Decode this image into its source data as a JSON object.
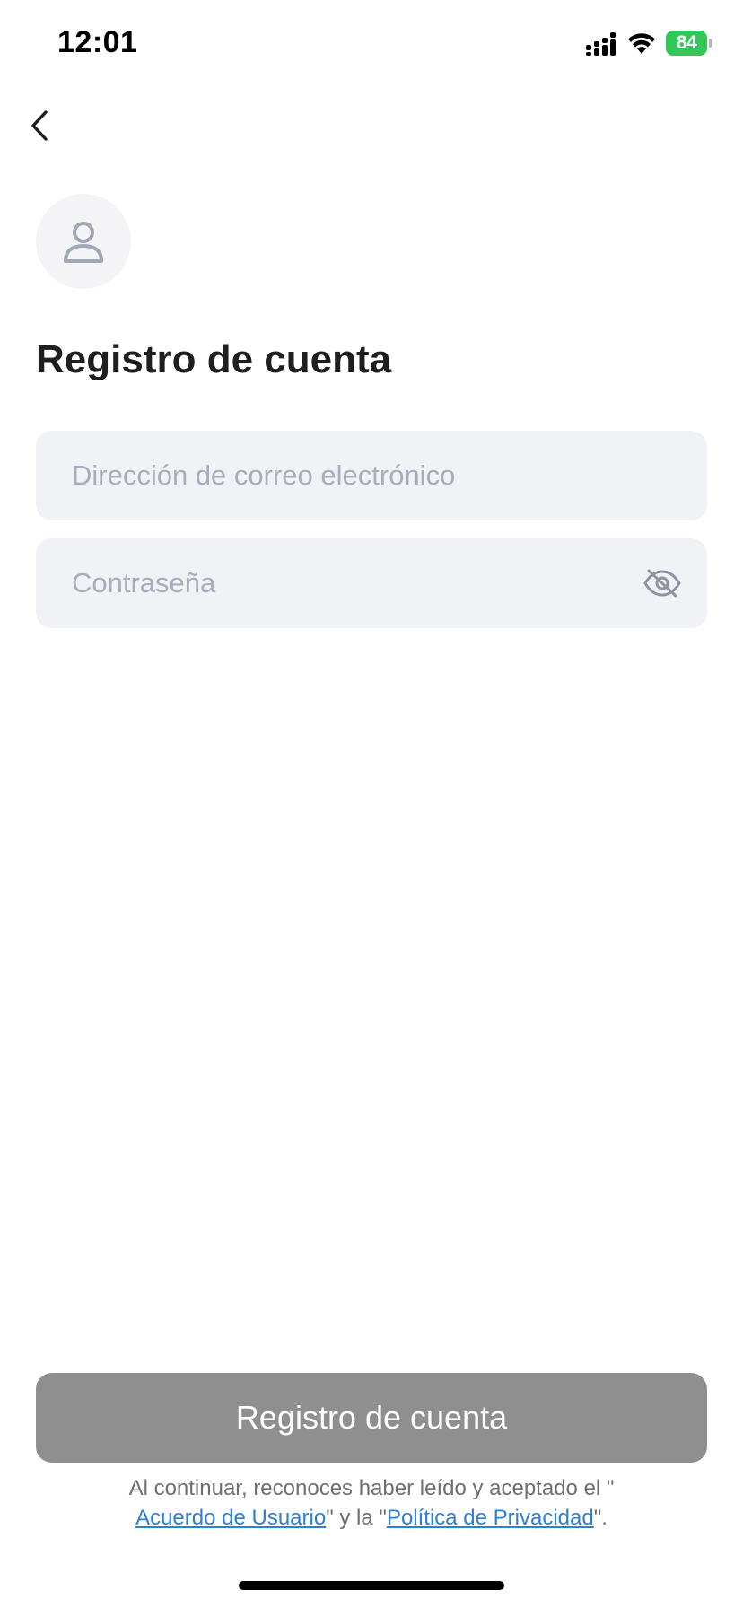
{
  "status_bar": {
    "time": "12:01",
    "battery_level": "84",
    "icons": [
      "signal-icon",
      "wifi-icon",
      "battery-icon"
    ]
  },
  "nav": {
    "back_icon": "chevron-left-icon"
  },
  "avatar": {
    "icon": "user-icon"
  },
  "page": {
    "title": "Registro de cuenta"
  },
  "form": {
    "email": {
      "value": "",
      "placeholder": "Dirección de correo electrónico"
    },
    "password": {
      "value": "",
      "placeholder": "Contraseña",
      "toggle_icon": "eye-off-icon"
    },
    "submit_label": "Registro de cuenta"
  },
  "legal": {
    "prefix": "Al continuar, reconoces haber leído y aceptado el \"",
    "user_agreement": "Acuerdo de Usuario",
    "middle": "\" y la \"",
    "privacy_policy": "Política de Privacidad",
    "suffix": "\"."
  },
  "colors": {
    "accent_link": "#2f7fd8",
    "button_disabled": "#8f8f8f",
    "field_background": "#f1f2f6",
    "battery_green": "#33c759"
  }
}
